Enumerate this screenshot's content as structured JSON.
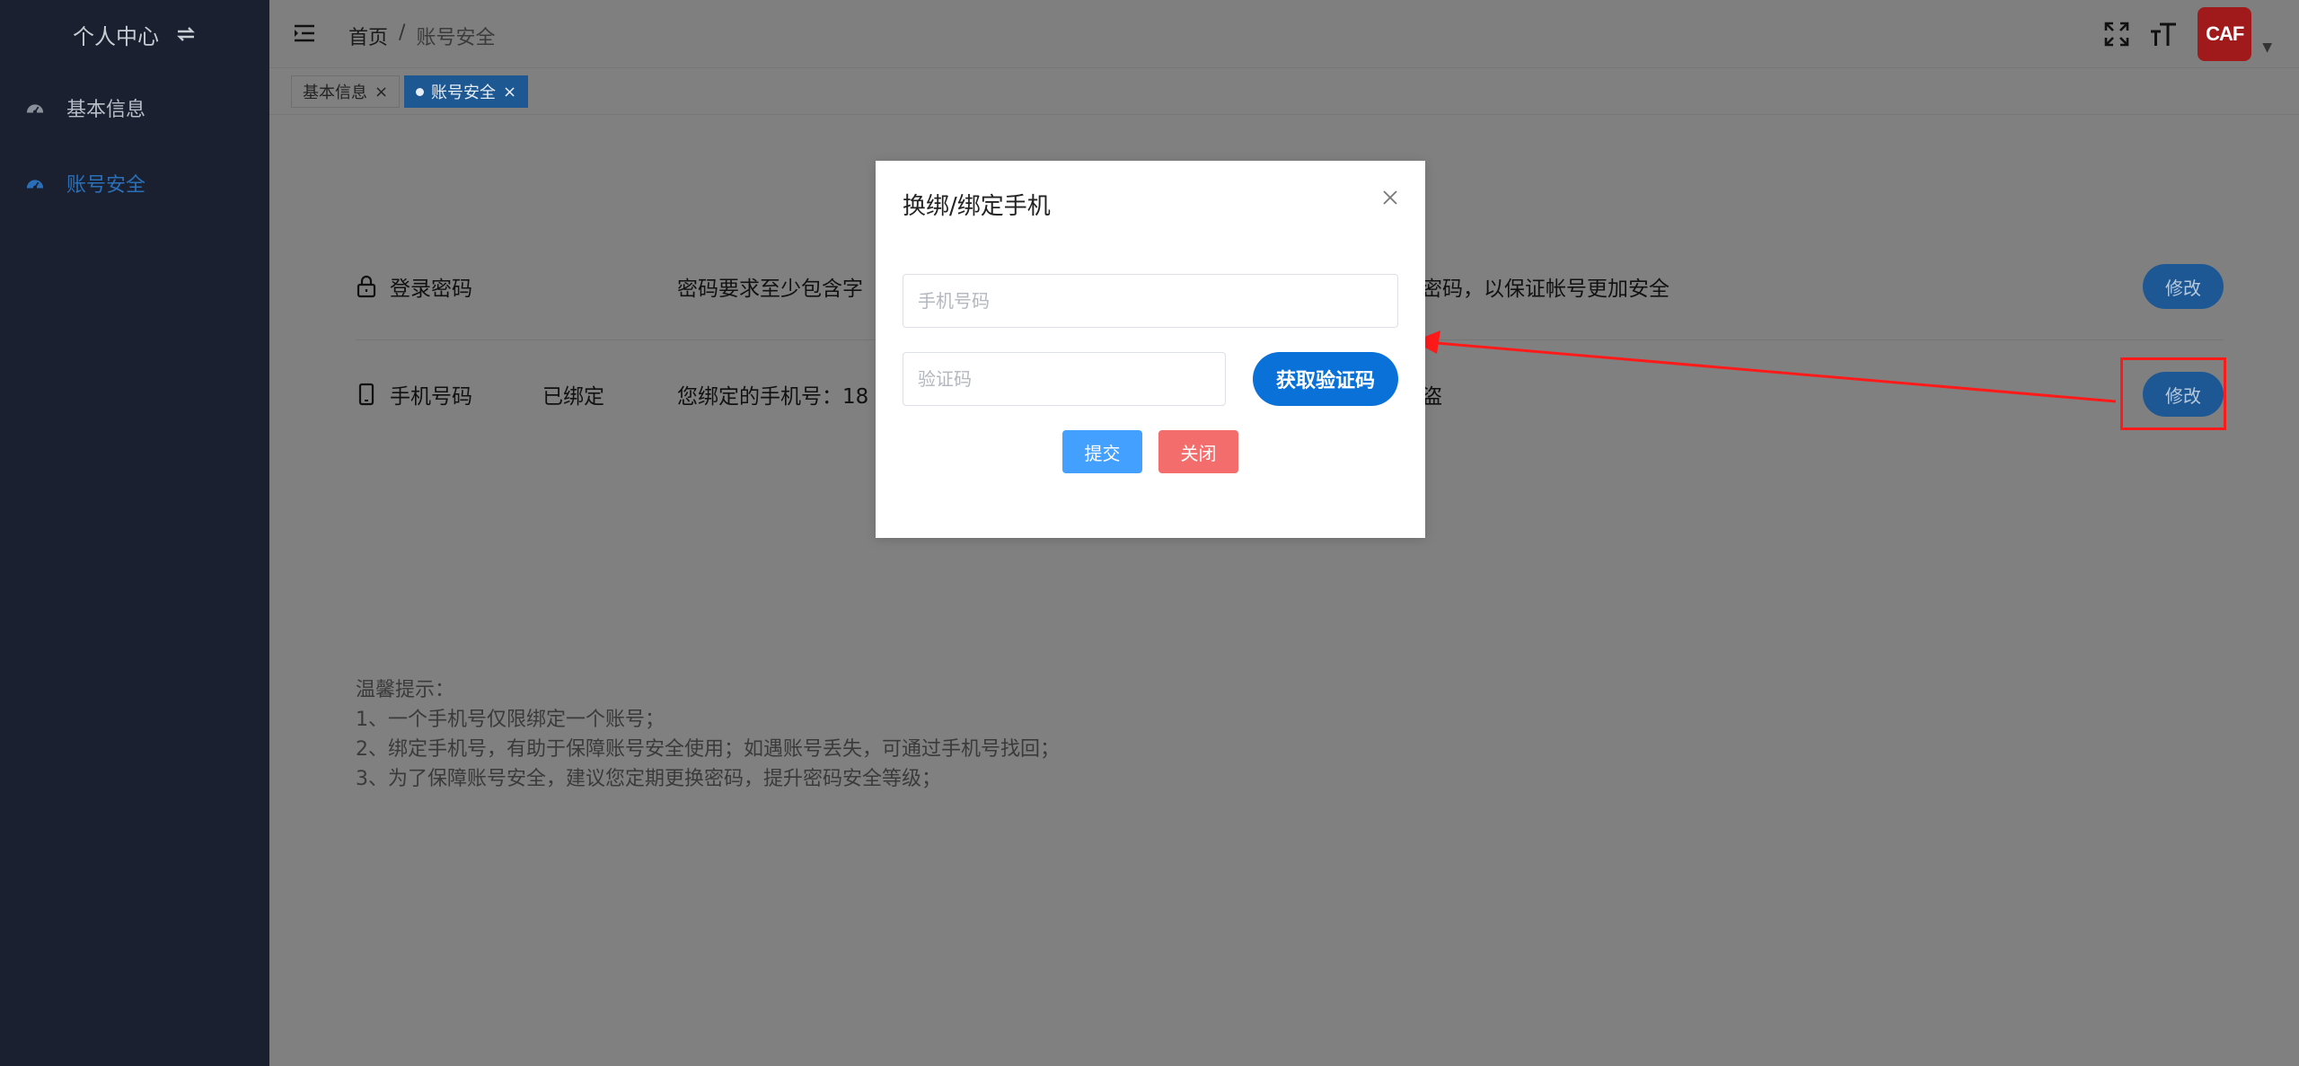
{
  "sidebar": {
    "title": "个人中心",
    "items": [
      {
        "label": "基本信息",
        "active": false
      },
      {
        "label": "账号安全",
        "active": true
      }
    ]
  },
  "header": {
    "breadcrumb": {
      "home": "首页",
      "separator": "/",
      "current": "账号安全"
    },
    "avatar_text": "CAF"
  },
  "tags": [
    {
      "label": "基本信息",
      "active": false
    },
    {
      "label": "账号安全",
      "active": true
    }
  ],
  "security": {
    "password": {
      "title": "登录密码",
      "status": "",
      "desc_left": "密码要求至少包含字",
      "desc_right": "密码，以保证帐号更加安全",
      "button": "修改"
    },
    "phone": {
      "title": "手机号码",
      "status": "已绑定",
      "desc_left": "您绑定的手机号：18",
      "desc_right": "盗",
      "button": "修改"
    }
  },
  "tips": {
    "heading": "温馨提示：",
    "lines": [
      "1、一个手机号仅限绑定一个账号；",
      "2、绑定手机号，有助于保障账号安全使用；如遇账号丢失，可通过手机号找回；",
      "3、为了保障账号安全，建议您定期更换密码，提升密码安全等级；"
    ]
  },
  "modal": {
    "title": "换绑/绑定手机",
    "phone_placeholder": "手机号码",
    "code_placeholder": "验证码",
    "get_code": "获取验证码",
    "submit": "提交",
    "close": "关闭"
  },
  "colors": {
    "sidebar_bg": "#1a2030",
    "primary": "#0a71d8",
    "submit": "#43a0ff",
    "close": "#f36d6d",
    "annotation": "#ff1a1a"
  }
}
